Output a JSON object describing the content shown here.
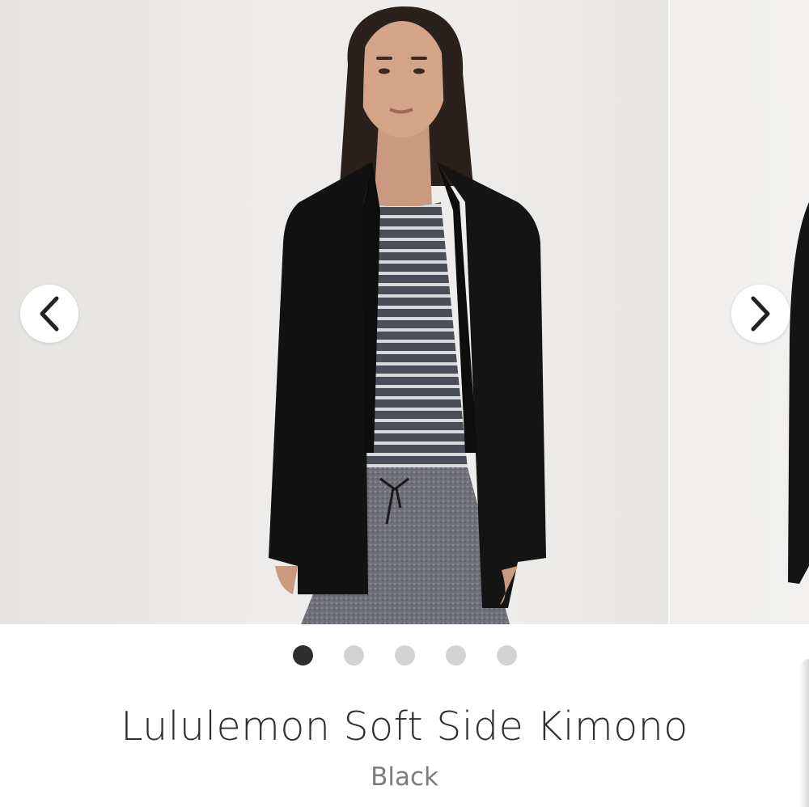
{
  "carousel": {
    "prev_icon": "chevron-left-icon",
    "next_icon": "chevron-right-icon",
    "slide_count": 5,
    "active_slide": 1
  },
  "product": {
    "name": "Lululemon Soft Side Kimono",
    "color": "Black"
  },
  "colors": {
    "title_text": "#2f2f2f",
    "subtitle_text": "#7d7d7d",
    "dot_active": "#2e2e2e",
    "dot_inactive": "#d3d3d3"
  }
}
